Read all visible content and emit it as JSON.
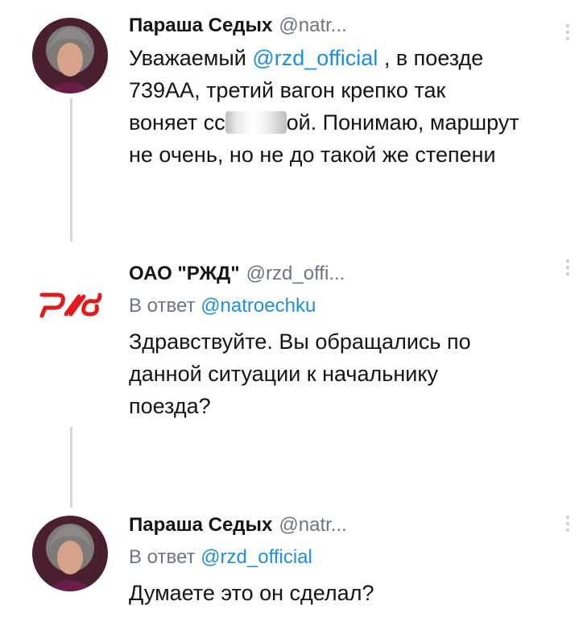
{
  "tweets": [
    {
      "author_name": "Параша Седых",
      "author_handle": "@natr...",
      "lines": [
        {
          "pre": "Уважаемый ",
          "mention": "@rzd_official",
          "post": " , в поезде"
        },
        "739АА, третий вагон крепко так",
        {
          "pre": "воняет сс",
          "post": "ой. Понимаю, маршрут"
        },
        "не очень, но не до такой же степени"
      ]
    },
    {
      "author_name": "ОАО \"РЖД\"",
      "author_handle": "@rzd_offi...",
      "reply_prefix": "В ответ ",
      "reply_to": "@natroechku",
      "lines": [
        "Здравствуйте. Вы обращались по",
        "данной ситуации к начальнику",
        "поезда?"
      ]
    },
    {
      "author_name": "Параша Седых",
      "author_handle": "@natr...",
      "reply_prefix": "В ответ ",
      "reply_to": "@rzd_official",
      "lines": [
        "Думаете это он сделал?"
      ]
    }
  ],
  "icons": {
    "more": "more-vertical-icon",
    "avatar": "user-avatar-photo",
    "logo": "rzd-logo"
  },
  "colors": {
    "mention": "#1d8fe0",
    "secondary_text": "#6b7680",
    "thread_line": "#cfd9de",
    "logo_red": "#e21a1a"
  }
}
